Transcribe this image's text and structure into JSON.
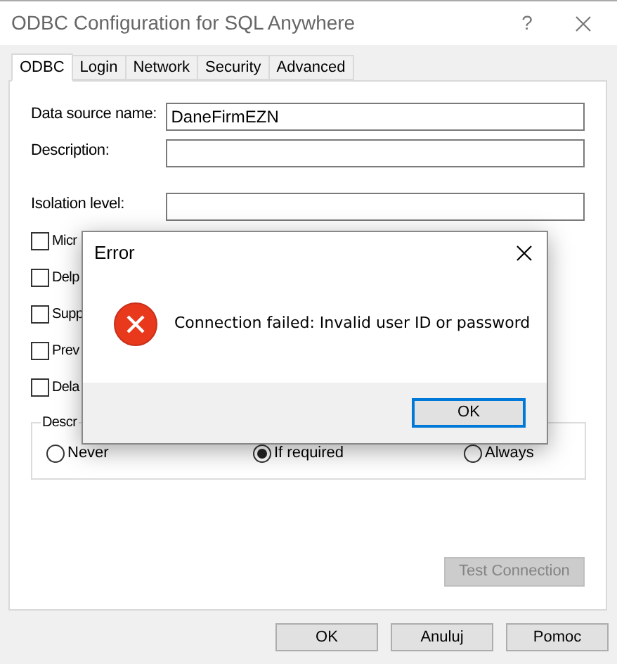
{
  "window": {
    "title": "ODBC Configuration for SQL Anywhere",
    "help": "?"
  },
  "tabs": [
    {
      "label": "ODBC",
      "selected": true
    },
    {
      "label": "Login",
      "selected": false
    },
    {
      "label": "Network",
      "selected": false
    },
    {
      "label": "Security",
      "selected": false
    },
    {
      "label": "Advanced",
      "selected": false
    }
  ],
  "fields": [
    {
      "label": "Data source name:",
      "value": "DaneFirmEZN"
    },
    {
      "label": "Description:"
    },
    {
      "label": "Isolation level:"
    }
  ],
  "checkboxes": [
    {
      "label": "Micr",
      "checked": false
    },
    {
      "label": "Delp",
      "checked": false
    },
    {
      "label": "Supp",
      "checked": false
    },
    {
      "label": "Prev",
      "checked": false
    },
    {
      "label": "Dela",
      "checked": false
    }
  ],
  "group": {
    "label": "Descr",
    "options": [
      {
        "label": "Never",
        "selected": false
      },
      {
        "label": "If required",
        "selected": true
      },
      {
        "label": "Always",
        "selected": false
      }
    ]
  },
  "test_button": {
    "label": "Test Connection",
    "disabled": true
  },
  "buttons": [
    "OK",
    "Anuluj",
    "Pomoc"
  ],
  "error_dialog": {
    "title": "Error",
    "message": "Connection failed: Invalid user ID or password",
    "button": "OK"
  }
}
